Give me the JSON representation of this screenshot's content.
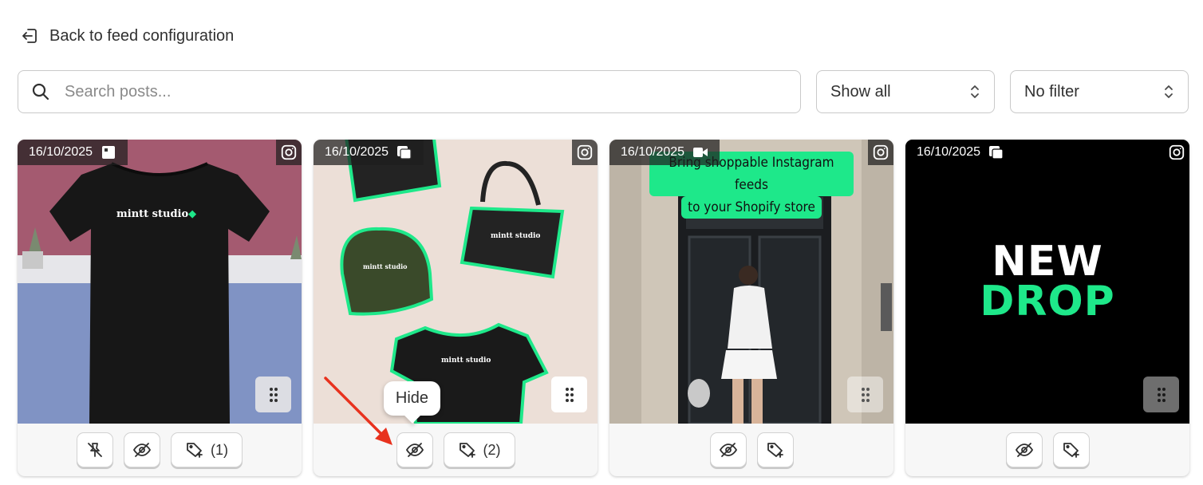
{
  "nav": {
    "back_label": "Back to feed configuration"
  },
  "search": {
    "placeholder": "Search posts...",
    "value": ""
  },
  "filters": {
    "show_select": "Show all",
    "filter_select": "No filter"
  },
  "tooltip": {
    "label": "Hide"
  },
  "brand": {
    "shirt_text": "mintt studio",
    "headline_line1": "Bring shoppable Instagram feeds",
    "headline_line2": "to your Shopify store",
    "drop_line1": "NEW",
    "drop_line2": "DROP"
  },
  "colors": {
    "accent": "#1ee88a",
    "text": "#303030",
    "border": "#c9c9c9"
  },
  "posts": [
    {
      "date": "16/10/2025",
      "type_icon": "image-icon",
      "tag_count": "(1)"
    },
    {
      "date": "16/10/2025",
      "type_icon": "carousel-icon",
      "tag_count": "(2)"
    },
    {
      "date": "16/10/2025",
      "type_icon": "video-icon",
      "tag_count": ""
    },
    {
      "date": "16/10/2025",
      "type_icon": "carousel-icon",
      "tag_count": ""
    }
  ]
}
